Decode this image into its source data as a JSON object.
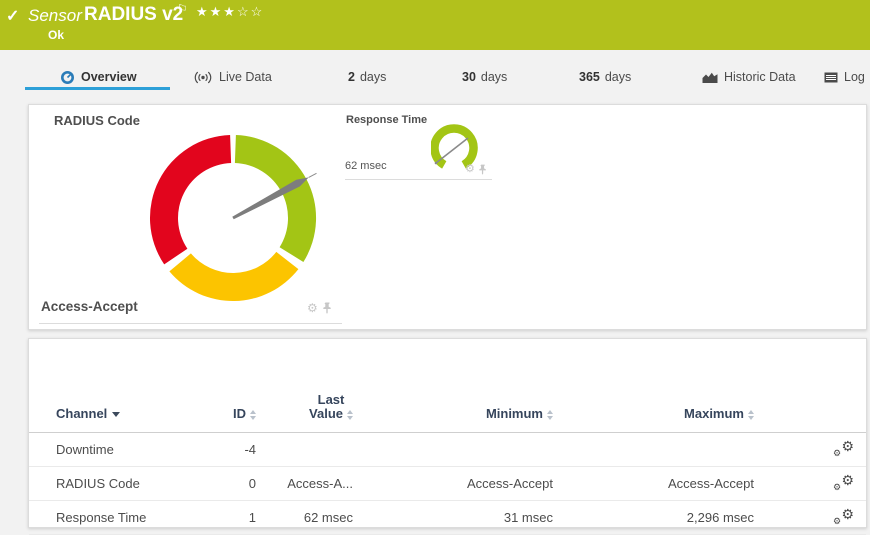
{
  "header": {
    "check_icon": "✓",
    "type_label": "Sensor",
    "title": "RADIUS v2",
    "flag_icon": "⚐",
    "stars_text": "★★★☆☆",
    "status": "Ok"
  },
  "tabs": [
    {
      "label": "Overview",
      "active": true
    },
    {
      "label": "Live Data"
    },
    {
      "value": "2",
      "label": "days"
    },
    {
      "value": "30",
      "label": "days"
    },
    {
      "value": "365",
      "label": "days"
    },
    {
      "label": "Historic Data"
    },
    {
      "label": "Log"
    }
  ],
  "colors": {
    "status_ok": "#b2c11c",
    "active_tab_underline": "#2da0d8",
    "needle": "#7d7d7d",
    "tab_icon_blue": "#2b7cb8"
  },
  "gauges": {
    "radius_code": {
      "title": "RADIUS Code",
      "status_label": "Access-Accept",
      "needle_angle_deg": 62,
      "segments": [
        {
          "name": "ok",
          "color": "#a3c515",
          "from_deg": 2,
          "to_deg": 122
        },
        {
          "name": "warning",
          "color": "#fcc400",
          "from_deg": 128,
          "to_deg": 230
        },
        {
          "name": "error",
          "color": "#e2051d",
          "from_deg": 236,
          "to_deg": 358
        }
      ]
    },
    "response_time": {
      "title": "Response Time",
      "value": "62 msec",
      "arc_color": "#a3c515",
      "needle_angle_deg": 52
    }
  },
  "table": {
    "header": {
      "channel": "Channel",
      "id": "ID",
      "last_value_line1": "Last",
      "last_value_line2": "Value",
      "minimum": "Minimum",
      "maximum": "Maximum"
    },
    "rows": [
      {
        "channel": "Downtime",
        "id": "-4",
        "last": "",
        "min": "",
        "max": ""
      },
      {
        "channel": "RADIUS Code",
        "id": "0",
        "last": "Access-A...",
        "min": "Access-Accept",
        "max": "Access-Accept"
      },
      {
        "channel": "Response Time",
        "id": "1",
        "last": "62 msec",
        "min": "31 msec",
        "max": "2,296 msec"
      }
    ]
  },
  "icons": {
    "gear": "⚙"
  }
}
